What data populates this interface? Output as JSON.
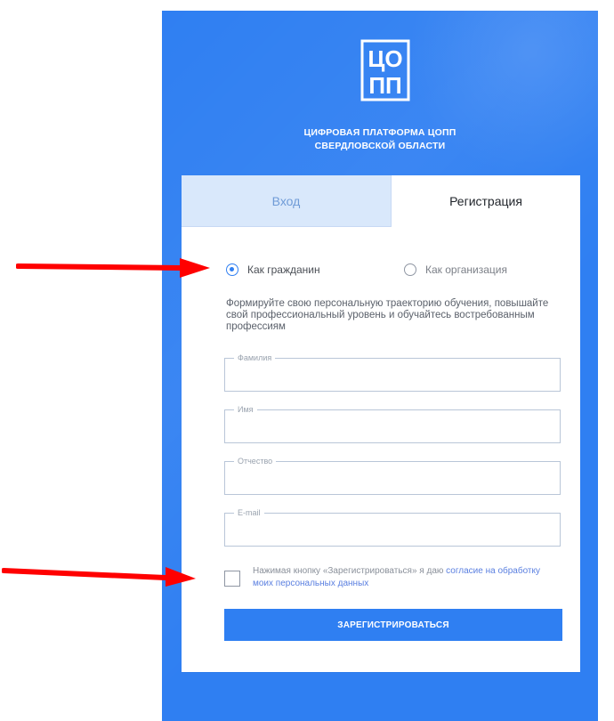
{
  "platform": {
    "logo": {
      "icon": "copp-logo-icon",
      "line1": "ЦО",
      "line2": "ПП"
    },
    "title_line1": "ЦИФРОВАЯ ПЛАТФОРМА ЦОПП",
    "title_line2": "СВЕРДЛОВСКОЙ ОБЛАСТИ"
  },
  "tabs": {
    "login": "Вход",
    "register": "Регистрация",
    "active": "register"
  },
  "registration": {
    "options": {
      "citizen": "Как гражданин",
      "organization": "Как организация",
      "selected": "citizen"
    },
    "description": "Формируйте свою персональную траекторию обучения, повышайте свой профессиональный уровень и обучайтесь востребованным профессиям",
    "fields": {
      "last_name": {
        "label": "Фамилия",
        "value": ""
      },
      "first_name": {
        "label": "Имя",
        "value": ""
      },
      "middle_name": {
        "label": "Отчество",
        "value": ""
      },
      "email": {
        "label": "E-mail",
        "value": ""
      }
    },
    "consent": {
      "checked": false,
      "text": "Нажимая кнопку «Зарегистрироваться» я даю ",
      "link_text": "согласие на обработку моих персональных данных"
    },
    "submit_label": "ЗАРЕГИСТРИРОВАТЬСЯ"
  },
  "colors": {
    "brand_blue": "#2f7ff2",
    "arrow_red": "#ff0000"
  },
  "annotations": {
    "arrows": [
      {
        "icon": "red-arrow-icon",
        "target": "radio-citizen"
      },
      {
        "icon": "red-arrow-icon",
        "target": "consent-checkbox"
      }
    ]
  }
}
